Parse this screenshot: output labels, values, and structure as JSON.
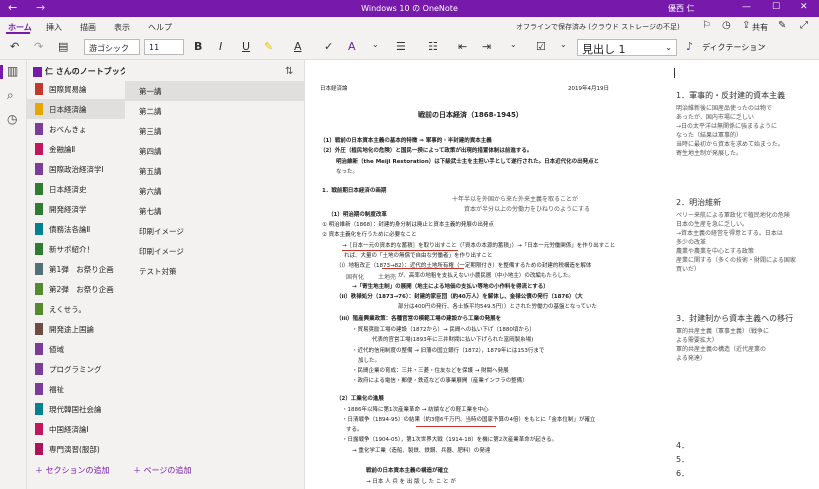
{
  "titlebar": {
    "title": "Windows 10 の OneNote",
    "user": "優西 仁",
    "back": "←",
    "forward": "→",
    "minimize": "—",
    "maximize": "☐",
    "close": "✕"
  },
  "ribbon": {
    "tabs": [
      "ホーム",
      "挿入",
      "描画",
      "表示",
      "ヘルプ"
    ],
    "status": "オフラインで保存済み (クラウド ストレージの不足)",
    "share": "共有",
    "font_name": "游ゴシック",
    "font_size": "11",
    "bold": "B",
    "italic": "I",
    "underline": "U",
    "style": "見出し 1",
    "dictate": "ディクテーション"
  },
  "notebook": {
    "name": "仁 さんのノートブック",
    "sections": [
      {
        "label": "国際貿易論",
        "color": "#c0392b"
      },
      {
        "label": "日本経済論",
        "color": "#e6a700"
      },
      {
        "label": "おべんきょ",
        "color": "#7d3c98"
      },
      {
        "label": "金融論Ⅱ",
        "color": "#c2185b"
      },
      {
        "label": "国際政治経済学Ⅰ",
        "color": "#7d3c98"
      },
      {
        "label": "日本経済史",
        "color": "#2e7d32"
      },
      {
        "label": "開発経済学",
        "color": "#2e7d32"
      },
      {
        "label": "債務法各論Ⅱ",
        "color": "#00838f"
      },
      {
        "label": "新サポ紹介！",
        "color": "#2e7d32"
      },
      {
        "label": "第1弾　お祭り企画",
        "color": "#546e7a"
      },
      {
        "label": "第2弾　お祭り企画",
        "color": "#558b2f"
      },
      {
        "label": "えくせう。",
        "color": "#558b2f"
      },
      {
        "label": "開発途上国論",
        "color": "#6d4c41"
      },
      {
        "label": "値域",
        "color": "#7d3c98"
      },
      {
        "label": "プログラミング",
        "color": "#7d3c98"
      },
      {
        "label": "福祉",
        "color": "#7d3c98"
      },
      {
        "label": "現代韓国社会論",
        "color": "#00838f"
      },
      {
        "label": "中国経済論Ⅰ",
        "color": "#c2185b"
      },
      {
        "label": "専門演習(服部)",
        "color": "#ad1457"
      }
    ],
    "add_section": "＋ セクションの追加"
  },
  "pages": {
    "items": [
      "第一講",
      "第二講",
      "第三講",
      "第四講",
      "第五講",
      "第六講",
      "第七講",
      "印刷イメージ",
      "印刷イメージ",
      "テスト対策"
    ],
    "add_page": "＋ ページの追加"
  },
  "doc": {
    "header_left": "日本経済論",
    "header_right": "2019年4月19日",
    "title": "戦前の日本経済（1868-1945）",
    "lines": [
      "（1）戦前の日本資本主義の基本的特徴 ⇒ 軍事的・半封建的資本主義",
      "（2）外圧（植民地化の危険）と国民一揆によって政策が出現的措置体制は前進する。",
      "明治維新（the Meiji Restoration）は下級武士主を主担い手として遂行された。日本近代化の出発点と",
      "なった。",
      "1．戦前期日本経済の画期",
      "（1）明治期の制度改革",
      "① 明治維新（1868）：封建的身分制は廃止と資本主義的発展の出発点",
      "② 資本主義化を行うために必要なこと",
      "→［日本一元の資本的な蓄積］を取り出すこと（「資本の本源的蓄積」）→「日本一元労働関係」を作り出すこと",
      "れば、大量の「土地の無償で自由な労働者」を作り出すこと",
      "（i）地租改正（1873→82）：近代的土地所有権（一定期限付き）を整備するための封建的税構造を解体",
      "が、高率の地租を支払えない小農民層（中小地主）の改編もたらした。",
      "→「寄生地主制」の展開（地主による地価の支払い等地の小作料を得流とする）",
      "（ii）秩禄処分（1873→76）：封建的家臣団（約40万人）を解体し、金禄公債の発行（1876）（大",
      "部分は400円の発行、各士族平均549.5円））とされた労働力の基盤となっていた",
      "（iii）殖産興業政策：各種官営の模範工場の建設から工業の発展を",
      "・貿易奨励工場の建設（1872から）→ 民間への払い下げ（1880頃から）",
      "代表的官営工場(1893年に三井財閥に払い下げられた富岡製糸場)",
      "・近代的信用制度の整備 → 旧藩の国立銀行（1872），1879年には153行まで",
      "加した。",
      "・民間企業の育成：三井・三菱・住友などを保護 → 財閥へ発展",
      "・政府による電信・郵便・鉄道などの事業展開（産業インフラの整備）",
      "（2）工業化の進展",
      "・1886年以降に第1次産業革命 → 紡績などの軽工業を中心",
      "・日清戦争（1894-95）の結果（約3億6千万円、当時の国家予算の4倍）をもとに「金本位制」が確立",
      "する。",
      "・日露戦争（1904-05），第1次世界大戦（1914-18）を機に第2次産業革命が起きる。",
      "→ 重化学工業（造船、製鉄、鉄鋼、兵器、肥料）の発達",
      "戦前の日本資本主義の構造が確立",
      "→ 日本 人 兵 を 出 版 し た こ と が"
    ],
    "handwriting": [
      "十年半以を外国から来た外来主義を取ることが",
      "資本が半分以上の労働力をひねりのようにする",
      "国有化",
      "土地売"
    ]
  },
  "side_notes": {
    "items": [
      {
        "heading": "1．軍事的・反封建的資本主義",
        "notes": [
          "明治維新後に国産品使ったのは物で",
          "あったが、国内市場に乏しい",
          "→日の太平洋は無関係に強まるように",
          "なった（結果は軍事的）",
          "当時に最初から資本を求めて始まった。",
          "寄生地主制が発展した。"
        ]
      },
      {
        "heading": "2．明治維新",
        "notes": [
          "ペリー来航による軍政化で植民地化の危険",
          "日本の生産を急に乏しい。",
          "→資本主義の経営を得意とする。日本は",
          "多少の改革",
          "農業や農業を中心とする政策",
          "産業に関する（多くの技術・財閥による国家",
          "買いだ）"
        ]
      },
      {
        "heading": "3．封建制から資本主義への移行",
        "notes": [
          "軍的共産主義（軍事主義）（戦争に",
          "よる需要拡大）",
          "軍的共産主義の構造（近代産業の",
          "よる発達）"
        ]
      }
    ],
    "tail": [
      "4．",
      "5．",
      "6．"
    ]
  }
}
